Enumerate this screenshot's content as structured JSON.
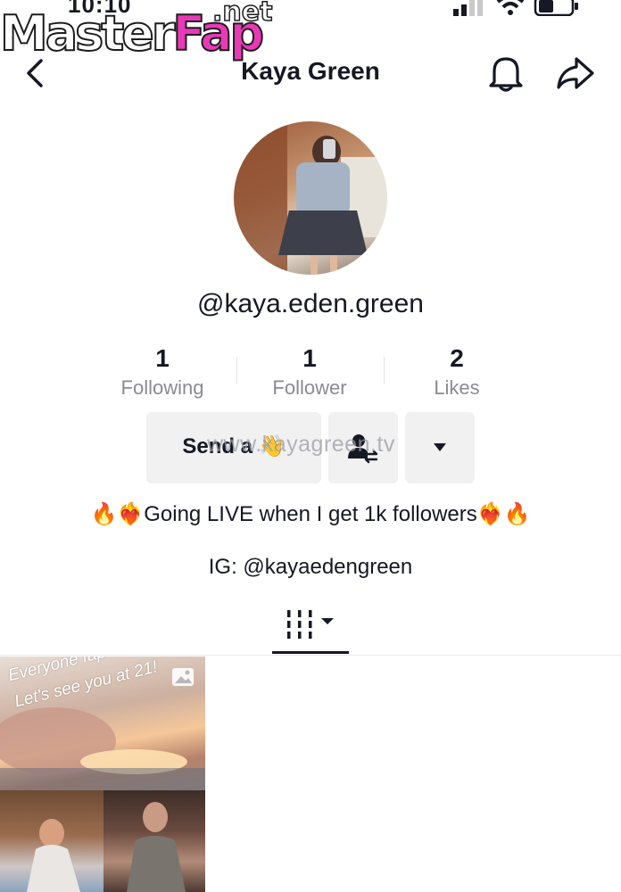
{
  "status_bar": {
    "time": "10:10"
  },
  "watermark": {
    "brand_part1": "Master",
    "brand_part2": "Fap",
    "brand_suffix": ".net",
    "url_overlay": "www.kayagreen.tv"
  },
  "header": {
    "title": "Kaya Green"
  },
  "profile": {
    "username": "@kaya.eden.green",
    "stats": [
      {
        "value": "1",
        "label": "Following"
      },
      {
        "value": "1",
        "label": "Follower"
      },
      {
        "value": "2",
        "label": "Likes"
      }
    ],
    "send_button_label": "Send a 👋",
    "bio": "🔥❤️‍🔥Going LIVE when I get 1k followers❤️‍🔥🔥",
    "ig": "IG: @kayaedengreen"
  },
  "videos": [
    {
      "overlay_line1": "Everyone fap me",
      "overlay_line2": "Let's see you at 21!"
    }
  ],
  "icons": {
    "back": "chevron-left-icon",
    "bell": "bell-icon",
    "share": "share-arrow-icon",
    "add_friend": "user-swap-icon",
    "more": "caret-down-icon",
    "grid": "grid-tab-icon"
  }
}
